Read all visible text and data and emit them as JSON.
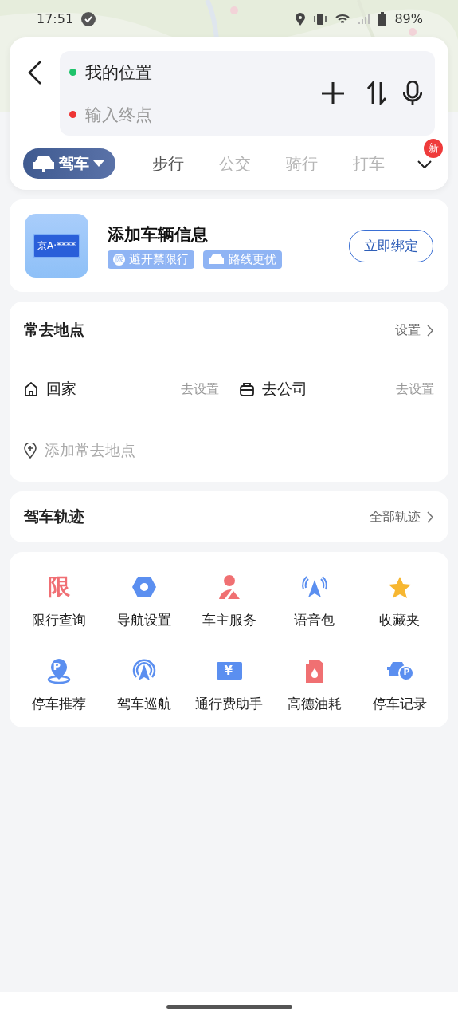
{
  "status_bar": {
    "time": "17:51",
    "battery": "89%"
  },
  "search": {
    "origin": "我的位置",
    "destination_placeholder": "输入终点"
  },
  "modes": [
    {
      "label": "驾车",
      "selected": true,
      "dimmed": false
    },
    {
      "label": "步行",
      "selected": false,
      "dimmed": false
    },
    {
      "label": "公交",
      "selected": false,
      "dimmed": true
    },
    {
      "label": "骑行",
      "selected": false,
      "dimmed": true
    },
    {
      "label": "打车",
      "selected": false,
      "dimmed": true
    }
  ],
  "more_badge": "新",
  "vehicle": {
    "plate": "京A·****",
    "title": "添加车辆信息",
    "tags": [
      {
        "kind": "limit",
        "glyph": "限",
        "label": "避开禁限行"
      },
      {
        "kind": "car",
        "label": "路线更优"
      }
    ],
    "button": "立即绑定"
  },
  "frequent": {
    "title": "常去地点",
    "action": "设置",
    "places": [
      {
        "kind": "home",
        "label": "回家",
        "action": "去设置"
      },
      {
        "kind": "work",
        "label": "去公司",
        "action": "去设置"
      }
    ],
    "add": "添加常去地点"
  },
  "tracks": {
    "title": "驾车轨迹",
    "action": "全部轨迹"
  },
  "tools": [
    {
      "kind": "limit",
      "glyph": "限",
      "label": "限行查询"
    },
    {
      "kind": "hexagon",
      "label": "导航设置"
    },
    {
      "kind": "person",
      "label": "车主服务"
    },
    {
      "kind": "voice",
      "label": "语音包"
    },
    {
      "kind": "star",
      "label": "收藏夹"
    },
    {
      "kind": "parking-pin",
      "glyph": "P",
      "label": "停车推荐"
    },
    {
      "kind": "cruise",
      "label": "驾车巡航"
    },
    {
      "kind": "toll",
      "glyph": "¥",
      "label": "通行费助手"
    },
    {
      "kind": "fuel",
      "label": "高德油耗"
    },
    {
      "kind": "car-parking",
      "glyph": "P",
      "label": "停车记录"
    }
  ]
}
